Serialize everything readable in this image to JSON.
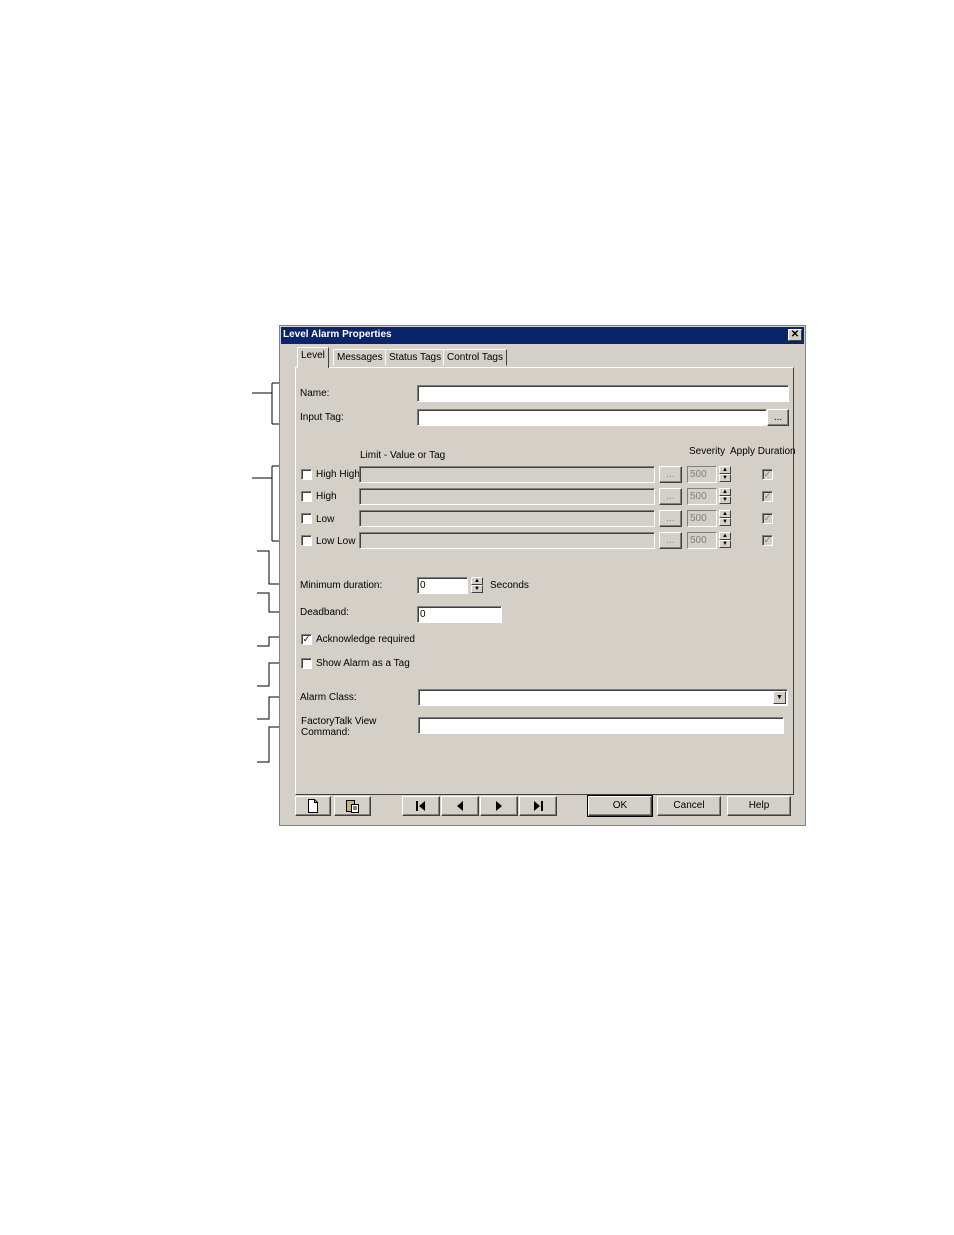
{
  "window": {
    "title": "Level Alarm Properties",
    "close_icon": "close-icon"
  },
  "tabs": [
    {
      "label": "Level",
      "active": true
    },
    {
      "label": "Messages",
      "active": false
    },
    {
      "label": "Status Tags",
      "active": false
    },
    {
      "label": "Control Tags",
      "active": false
    }
  ],
  "form": {
    "name_label": "Name:",
    "name_value": "",
    "input_tag_label": "Input Tag:",
    "input_tag_value": "",
    "browse_label": "...",
    "limit_header": "Limit - Value or Tag",
    "severity_header": "Severity",
    "apply_duration_header": "Apply Duration",
    "levels": [
      {
        "label": "High High",
        "checked": false,
        "limit": "",
        "severity": "500",
        "apply_duration": true
      },
      {
        "label": "High",
        "checked": false,
        "limit": "",
        "severity": "500",
        "apply_duration": true
      },
      {
        "label": "Low",
        "checked": false,
        "limit": "",
        "severity": "500",
        "apply_duration": true
      },
      {
        "label": "Low Low",
        "checked": false,
        "limit": "",
        "severity": "500",
        "apply_duration": true
      }
    ],
    "min_duration_label": "Minimum duration:",
    "min_duration_value": "0",
    "min_duration_unit": "Seconds",
    "deadband_label": "Deadband:",
    "deadband_value": "0",
    "ack_required_label": "Acknowledge required",
    "ack_required_checked": true,
    "show_as_tag_label": "Show Alarm as a Tag",
    "show_as_tag_checked": false,
    "alarm_class_label": "Alarm Class:",
    "alarm_class_value": "",
    "command_label_line1": "FactoryTalk View",
    "command_label_line2": "Command:",
    "command_value": ""
  },
  "footer": {
    "new_icon": "new-document-icon",
    "paste_icon": "paste-icon",
    "first_icon": "first-record-icon",
    "prev_icon": "previous-record-icon",
    "next_icon": "next-record-icon",
    "last_icon": "last-record-icon",
    "ok_label": "OK",
    "cancel_label": "Cancel",
    "help_label": "Help"
  },
  "colors": {
    "title_bar": "#0a246a",
    "dialog_bg": "#d4d0c8"
  }
}
